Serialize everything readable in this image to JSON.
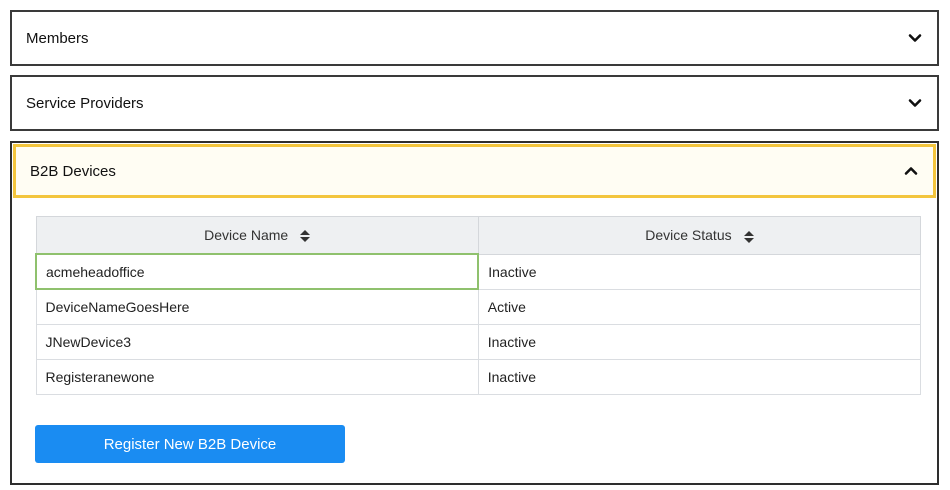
{
  "panels": [
    {
      "title": "Members",
      "expanded": false,
      "icon": "chevron-down-icon"
    },
    {
      "title": "Service Providers",
      "expanded": false,
      "icon": "chevron-down-icon"
    },
    {
      "title": "B2B Devices",
      "expanded": true,
      "icon": "chevron-up-icon"
    }
  ],
  "devices_table": {
    "headers": [
      "Device Name",
      "Device Status"
    ],
    "sort_icon": "sort-icon",
    "rows": [
      {
        "name": "acmeheadoffice",
        "status": "Inactive",
        "selected": true
      },
      {
        "name": "DeviceNameGoesHere",
        "status": "Active"
      },
      {
        "name": "JNewDevice3",
        "status": "Inactive"
      },
      {
        "name": "Registeranewone",
        "status": "Inactive"
      }
    ]
  },
  "register_button": {
    "label": "Register New B2B Device"
  },
  "colors": {
    "accent_blue": "#1a8cf2",
    "focus_yellow": "#f3c53d",
    "selected_green": "#8fc16d",
    "header_gray": "#eef0f2"
  }
}
